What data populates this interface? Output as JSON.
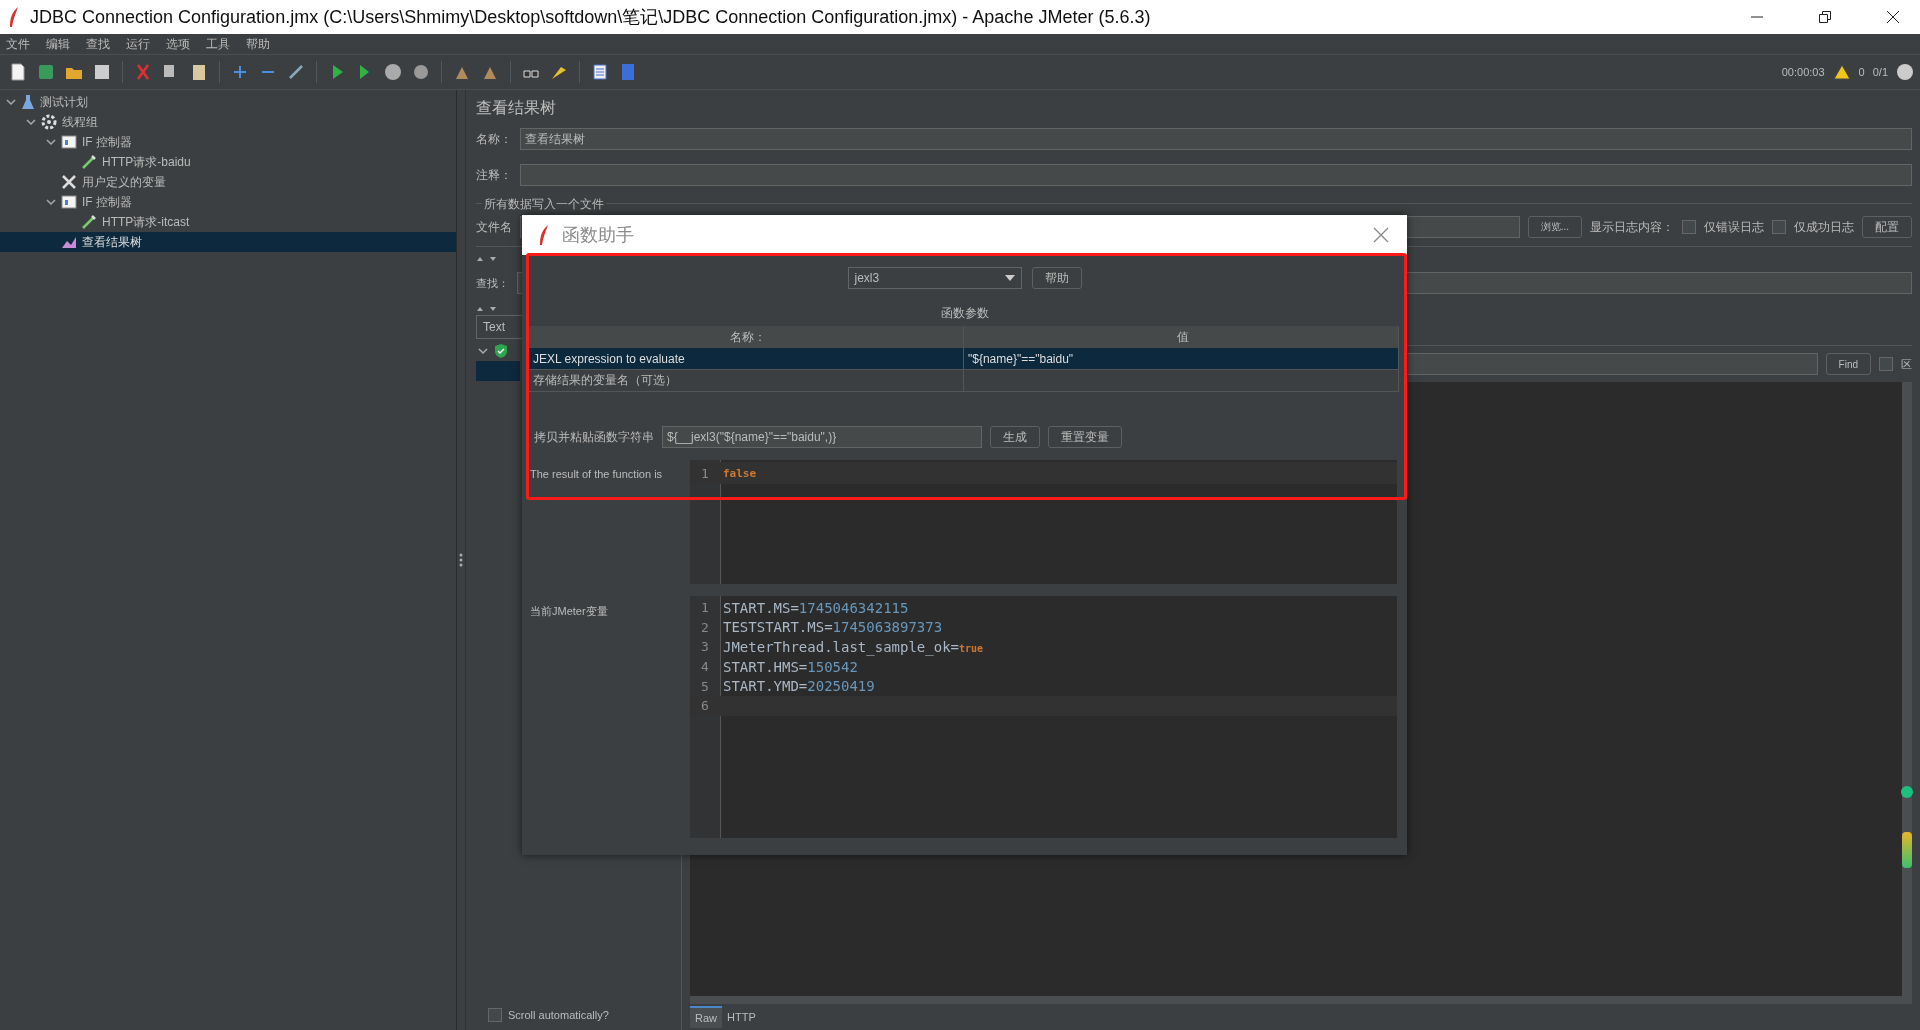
{
  "window": {
    "title": "JDBC Connection Configuration.jmx (C:\\Users\\Shmimy\\Desktop\\softdown\\笔记\\JDBC Connection Configuration.jmx) - Apache JMeter (5.6.3)"
  },
  "menu": [
    "文件",
    "编辑",
    "查找",
    "运行",
    "选项",
    "工具",
    "帮助"
  ],
  "status": {
    "elapsed": "00:00:03",
    "warnings": "0",
    "threads": "0/1"
  },
  "tree": [
    {
      "label": "测试计划",
      "kind": "plan",
      "expanded": true,
      "selected": false,
      "children": [
        {
          "label": "线程组",
          "kind": "thread_group",
          "expanded": true,
          "selected": false,
          "children": [
            {
              "label": "IF 控制器",
              "kind": "controller",
              "expanded": true,
              "selected": false,
              "children": [
                {
                  "label": "HTTP请求-baidu",
                  "kind": "sampler",
                  "selected": false
                }
              ]
            },
            {
              "label": "用户定义的变量",
              "kind": "config",
              "selected": false
            },
            {
              "label": "IF 控制器",
              "kind": "controller",
              "expanded": true,
              "selected": false,
              "children": [
                {
                  "label": "HTTP请求-itcast",
                  "kind": "sampler",
                  "selected": false
                }
              ]
            },
            {
              "label": "查看结果树",
              "kind": "listener",
              "selected": true
            }
          ]
        }
      ]
    }
  ],
  "panel": {
    "title": "查看结果树",
    "name_label": "名称：",
    "name_value": "查看结果树",
    "comment_label": "注释：",
    "file_group_title": "所有数据写入一个文件",
    "file_label": "文件名",
    "browse_button": "浏览...",
    "log_label": "显示日志内容：",
    "log_options": [
      {
        "label": "仅错误日志",
        "checked": false
      },
      {
        "label": "仅成功日志",
        "checked": false
      }
    ],
    "config_button": "配置",
    "search_label": "查找：",
    "renderer": "Text",
    "result_rows": [
      {
        "kind": "success",
        "selected": false
      },
      {
        "kind": "plain",
        "selected": true
      }
    ],
    "find_button": "Find",
    "case_option": {
      "label": "区",
      "checked": false
    },
    "scroll_option": {
      "label": "Scroll automatically?",
      "checked": false
    },
    "tabs": [
      {
        "label": "Raw",
        "selected": true
      },
      {
        "label": "HTTP",
        "selected": false
      }
    ]
  },
  "dialog": {
    "title": "函数助手",
    "function": "jexl3",
    "help_button": "帮助",
    "params_title": "函数参数",
    "columns": [
      "名称：",
      "值"
    ],
    "params": [
      {
        "name": "JEXL expression to evaluate",
        "value": "\"${name}\"==\"baidu\"",
        "selected": true
      },
      {
        "name": "存储结果的变量名（可选）",
        "selected": false
      }
    ],
    "copy_label": "拷贝并粘贴函数字符串",
    "copy_value": "${__jexl3(\"${name}\"==\"baidu\",)}",
    "generate_button": "生成",
    "reset_button": "重置变量",
    "result_label": "The result of the function is",
    "result_lines": [
      {
        "number": "1",
        "value": "false",
        "kind": "boolean",
        "current": true
      }
    ],
    "vars_label": "当前JMeter变量",
    "vars_lines": [
      {
        "number": "1",
        "key": "START.MS=",
        "value": "1745046342115",
        "kind": "number",
        "current": false
      },
      {
        "number": "2",
        "key": "TESTSTART.MS=",
        "value": "1745063897373",
        "kind": "number",
        "current": false
      },
      {
        "number": "3",
        "key": "JMeterThread.last_sample_ok=",
        "value": "true",
        "kind": "boolean",
        "current": false
      },
      {
        "number": "4",
        "key": "START.HMS=",
        "value": "150542",
        "kind": "number",
        "current": false
      },
      {
        "number": "5",
        "key": "START.YMD=",
        "value": "20250419",
        "kind": "number",
        "current": false
      },
      {
        "number": "6",
        "current": true
      }
    ]
  }
}
